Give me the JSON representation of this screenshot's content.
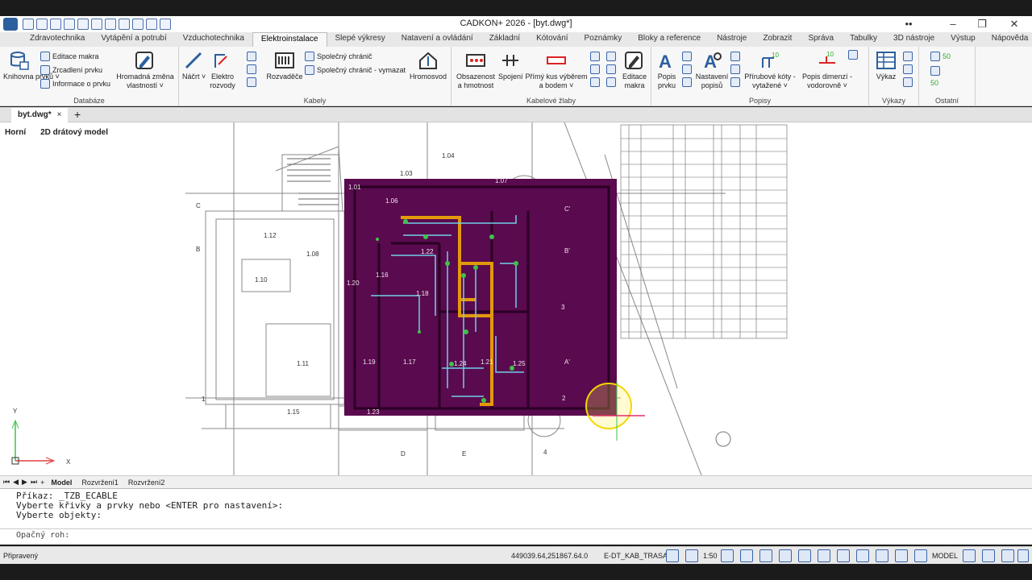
{
  "window": {
    "title": "CADKON+ 2026 - [byt.dwg*]",
    "tray": "••",
    "min": "–",
    "restore": "❐",
    "close": "✕"
  },
  "menu": [
    "Zdravotechnika",
    "Vytápění a potrubí",
    "Vzduchotechnika",
    "Elektroinstalace",
    "Slepé výkresy",
    "Natavení a ovládání",
    "Základní",
    "Kótování",
    "Poznámky",
    "Bloky a reference",
    "Nástroje",
    "Zobrazit",
    "Správa",
    "Tabulky",
    "3D nástroje",
    "Výstup",
    "Nápověda"
  ],
  "active_menu": "Elektroinstalace",
  "ribbon": {
    "databaze": {
      "title": "Databáze",
      "knihovna": "Knihovna prvků ˅",
      "editace": "Editace makra",
      "zrcadleni": "Zrcadlení prvku",
      "informace": "Informace o prvku",
      "hromadna": "Hromadná změna vlastností ˅"
    },
    "kabely": {
      "title": "Kabely",
      "nacrt": "Náčrt ˅",
      "elektro": "Elektro rozvody",
      "rozvadece": "Rozvaděče",
      "spolecny": "Společný chránič",
      "spolecny_vymazat": "Společný chránič - vymazat",
      "hromosvod": "Hromosvod"
    },
    "zlaby": {
      "title": "Kabelové žlaby",
      "obsazenost": "Obsazenost a hmotnost",
      "spojeni": "Spojení",
      "primy": "Přímý kus výběrem a bodem ˅",
      "editace_makra": "Editace makra"
    },
    "popisy": {
      "title": "Popisy",
      "popis_prvku": "Popis prvku",
      "nastaveni_popisu": "Nastavení popisů",
      "prirubove": "Přírubové kóty - vytažené ˅",
      "popis_dimenzi": "Popis dimenzí - vodorovně ˅",
      "num_10a": "10",
      "num_10b": "10"
    },
    "vykazy": {
      "title": "Výkazy",
      "vykaz": "Výkaz"
    },
    "ostatni": {
      "title": "Ostatní",
      "val1": "50",
      "val2": "50"
    }
  },
  "doc_tab": "byt.dwg*",
  "doc_tab_close": "×",
  "doc_tab_add": "+",
  "view": {
    "direction": "Horní",
    "style": "2D drátový model"
  },
  "drawing_labels": [
    "1.04",
    "1.03",
    "1.01",
    "1.06",
    "1.07",
    "1.12",
    "1.08",
    "1.10",
    "1.20",
    "1.16",
    "1.22",
    "1.18",
    "1.19",
    "1.17",
    "1.24",
    "1.25",
    "1.11",
    "1.15",
    "1.23",
    "1.21",
    "B",
    "B'",
    "C",
    "C'",
    "A'",
    "D",
    "E",
    "Y",
    "X",
    "1",
    "2",
    "3",
    "4"
  ],
  "layout_tabs": [
    "Model",
    "Rozvržení1",
    "Rozvržení2"
  ],
  "command_lines": [
    "Příkaz: _TZB_ECABLE",
    "Vyberte křivky a prvky nebo <ENTER pro nastavení>:",
    "Vyberte objekty:"
  ],
  "command_prompt": "Opačný roh:",
  "status": {
    "state": "Připravený",
    "coords": "449039.64,251867.64.0",
    "layer": "E-DT_KAB_TRASA",
    "scale": "1:50",
    "mode": "MODEL"
  },
  "colors": {
    "purple": "#5a0a4e",
    "orange": "#e29a0a",
    "cyan": "#6fd0ea",
    "green": "#3fc24a",
    "accent": "#2c5f9e"
  }
}
